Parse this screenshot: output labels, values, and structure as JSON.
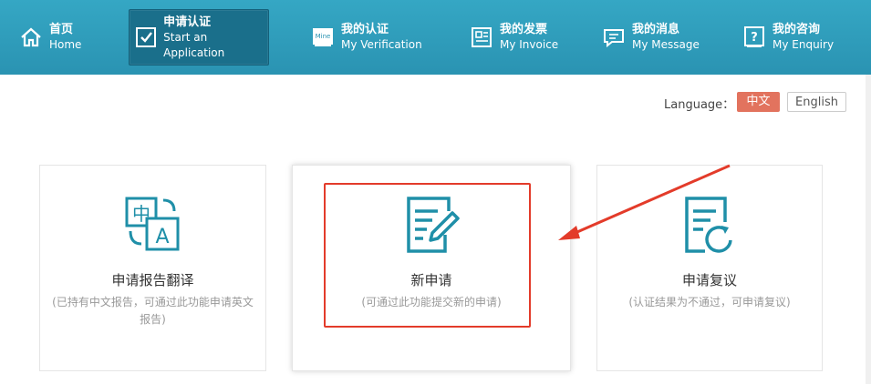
{
  "nav": {
    "items": [
      {
        "zh": "首页",
        "en": "Home",
        "icon": "home-icon",
        "active": false
      },
      {
        "zh": "申请认证",
        "en": "Start an Application",
        "icon": "checkbox-icon",
        "active": true
      },
      {
        "zh": "我的认证",
        "en": "My Verification",
        "icon": "mine-icon",
        "active": false
      },
      {
        "zh": "我的发票",
        "en": "My Invoice",
        "icon": "invoice-icon",
        "active": false
      },
      {
        "zh": "我的消息",
        "en": "My Message",
        "icon": "message-icon",
        "active": false
      },
      {
        "zh": "我的咨询",
        "en": "My Enquiry",
        "icon": "enquiry-icon",
        "active": false
      }
    ],
    "mine_icon_text": "Mine"
  },
  "language": {
    "label": "Language：",
    "zh": "中文",
    "en": "English"
  },
  "cards": [
    {
      "title": "申请报告翻译",
      "desc": "(已持有中文报告，可通过此功能申请英文报告)",
      "icon": "translate-icon",
      "icon_zh": "中",
      "icon_en": "A"
    },
    {
      "title": "新申请",
      "desc": "(可通过此功能提交新的申请)",
      "icon": "new-application-icon"
    },
    {
      "title": "申请复议",
      "desc": "(认证结果为不通过，可申请复议)",
      "icon": "reconsideration-icon"
    }
  ],
  "colors": {
    "nav": "#2a93b2",
    "accent": "#1f8fa8",
    "lang_active": "#e2735e",
    "highlight": "#e33b2a"
  }
}
